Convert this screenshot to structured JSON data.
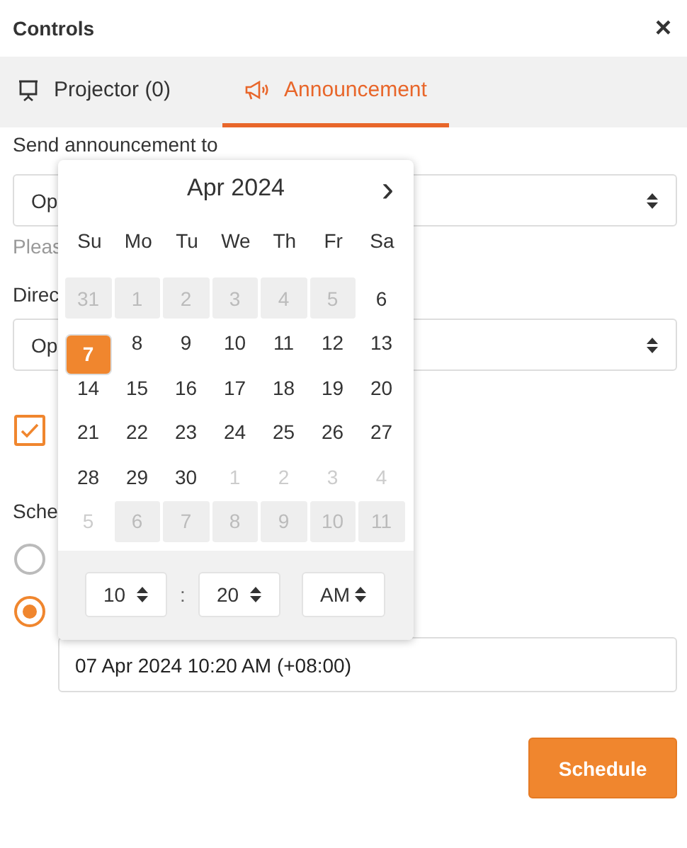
{
  "window": {
    "title": "Controls",
    "close": "×"
  },
  "tabs": [
    {
      "label": "Projector (0)",
      "selected": false
    },
    {
      "label": "Announcement",
      "selected": true
    }
  ],
  "form": {
    "send_label": "Send announcement to",
    "send_select": {
      "value": "Op"
    },
    "send_hint": "Pleas",
    "direct_label": "Direc",
    "direct_select": {
      "value": "Op"
    },
    "checkbox": {
      "checked": true
    },
    "schedule_label": "Sche",
    "radios": [
      {
        "selected": false
      },
      {
        "selected": true
      }
    ],
    "date_field": {
      "value": "07 Apr 2024 10:20 AM (+08:00)"
    }
  },
  "calendar": {
    "month": "Apr 2024",
    "next": "›",
    "weekdays": [
      "Su",
      "Mo",
      "Tu",
      "We",
      "Th",
      "Fr",
      "Sa"
    ],
    "days": [
      {
        "label": "31",
        "outside": true,
        "disabled": true,
        "selected": false
      },
      {
        "label": "1",
        "outside": false,
        "disabled": true,
        "selected": false
      },
      {
        "label": "2",
        "outside": false,
        "disabled": true,
        "selected": false
      },
      {
        "label": "3",
        "outside": false,
        "disabled": true,
        "selected": false
      },
      {
        "label": "4",
        "outside": false,
        "disabled": true,
        "selected": false
      },
      {
        "label": "5",
        "outside": false,
        "disabled": true,
        "selected": false
      },
      {
        "label": "6",
        "outside": false,
        "disabled": false,
        "selected": false
      },
      {
        "label": "7",
        "outside": false,
        "disabled": false,
        "selected": true
      },
      {
        "label": "8",
        "outside": false,
        "disabled": false,
        "selected": false
      },
      {
        "label": "9",
        "outside": false,
        "disabled": false,
        "selected": false
      },
      {
        "label": "10",
        "outside": false,
        "disabled": false,
        "selected": false
      },
      {
        "label": "11",
        "outside": false,
        "disabled": false,
        "selected": false
      },
      {
        "label": "12",
        "outside": false,
        "disabled": false,
        "selected": false
      },
      {
        "label": "13",
        "outside": false,
        "disabled": false,
        "selected": false
      },
      {
        "label": "14",
        "outside": false,
        "disabled": false,
        "selected": false
      },
      {
        "label": "15",
        "outside": false,
        "disabled": false,
        "selected": false
      },
      {
        "label": "16",
        "outside": false,
        "disabled": false,
        "selected": false
      },
      {
        "label": "17",
        "outside": false,
        "disabled": false,
        "selected": false
      },
      {
        "label": "18",
        "outside": false,
        "disabled": false,
        "selected": false
      },
      {
        "label": "19",
        "outside": false,
        "disabled": false,
        "selected": false
      },
      {
        "label": "20",
        "outside": false,
        "disabled": false,
        "selected": false
      },
      {
        "label": "21",
        "outside": false,
        "disabled": false,
        "selected": false
      },
      {
        "label": "22",
        "outside": false,
        "disabled": false,
        "selected": false
      },
      {
        "label": "23",
        "outside": false,
        "disabled": false,
        "selected": false
      },
      {
        "label": "24",
        "outside": false,
        "disabled": false,
        "selected": false
      },
      {
        "label": "25",
        "outside": false,
        "disabled": false,
        "selected": false
      },
      {
        "label": "26",
        "outside": false,
        "disabled": false,
        "selected": false
      },
      {
        "label": "27",
        "outside": false,
        "disabled": false,
        "selected": false
      },
      {
        "label": "28",
        "outside": false,
        "disabled": false,
        "selected": false
      },
      {
        "label": "29",
        "outside": false,
        "disabled": false,
        "selected": false
      },
      {
        "label": "30",
        "outside": false,
        "disabled": false,
        "selected": false
      },
      {
        "label": "1",
        "outside": true,
        "disabled": false,
        "selected": false
      },
      {
        "label": "2",
        "outside": true,
        "disabled": false,
        "selected": false
      },
      {
        "label": "3",
        "outside": true,
        "disabled": false,
        "selected": false
      },
      {
        "label": "4",
        "outside": true,
        "disabled": false,
        "selected": false
      },
      {
        "label": "5",
        "outside": true,
        "disabled": false,
        "selected": false
      },
      {
        "label": "6",
        "outside": true,
        "disabled": true,
        "selected": false
      },
      {
        "label": "7",
        "outside": true,
        "disabled": true,
        "selected": false
      },
      {
        "label": "8",
        "outside": true,
        "disabled": true,
        "selected": false
      },
      {
        "label": "9",
        "outside": true,
        "disabled": true,
        "selected": false
      },
      {
        "label": "10",
        "outside": true,
        "disabled": true,
        "selected": false
      },
      {
        "label": "11",
        "outside": true,
        "disabled": true,
        "selected": false
      }
    ],
    "time": {
      "hour": "10",
      "separator": ":",
      "minute": "20",
      "period": "AM"
    }
  },
  "buttons": [
    {
      "label": "Schedule"
    }
  ]
}
